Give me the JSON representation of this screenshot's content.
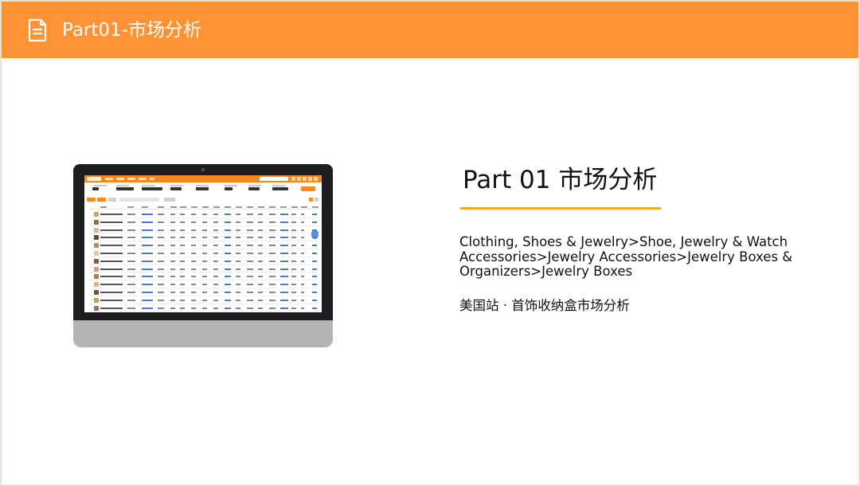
{
  "header": {
    "title": "Part01-市场分析",
    "icon": "document-icon",
    "background_color": "#fe9234"
  },
  "section": {
    "title": "Part 01  市场分析",
    "category_path": "Clothing, Shoes & Jewelry>Shoe, Jewelry & Watch Accessories>Jewelry Accessories>Jewelry Boxes & Organizers>Jewelry Boxes",
    "subtitle": "美国站 · 首饰收纳盒市场分析",
    "accent_color": "#f5a623"
  },
  "monitor": {
    "content": "product-research-dashboard-screenshot",
    "accent_color": "#f5891f"
  }
}
